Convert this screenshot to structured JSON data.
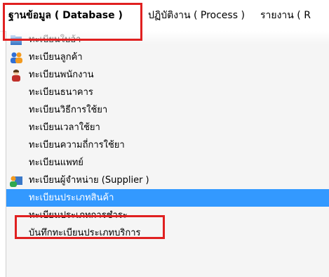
{
  "menubar": {
    "items": [
      {
        "label": "ฐานข้อมูล ( Database )"
      },
      {
        "label": "ปฏิบัติงาน ( Process )"
      },
      {
        "label": "รายงาน ( R"
      }
    ]
  },
  "dropdown": {
    "items": [
      {
        "label": "ทะเบียนใบอ้า",
        "icon": "folder-icon"
      },
      {
        "label": "ทะเบียนลูกค้า",
        "icon": "users-icon"
      },
      {
        "label": "ทะเบียนพนักงาน",
        "icon": "person-icon"
      },
      {
        "label": "ทะเบียนธนาคาร"
      },
      {
        "label": "ทะเบียนวิธีการใช้ยา"
      },
      {
        "label": "ทะเบียนเวลาใช้ยา"
      },
      {
        "label": "ทะเบียนความถี่การใช้ยา"
      },
      {
        "label": "ทะเบียนแพทย์"
      },
      {
        "label": "ทะเบียนผู้จำหน่าย (Supplier )",
        "icon": "supplier-icon"
      },
      {
        "label": "ทะเบียนประเภทสินค้า",
        "selected": true
      },
      {
        "label": "ทะเบียนประเภทการชำระ"
      },
      {
        "label": "บันทึกทะเบียนประเภทบริการ"
      }
    ]
  },
  "colors": {
    "selection": "#3399ff",
    "highlight_box": "#e02020"
  }
}
